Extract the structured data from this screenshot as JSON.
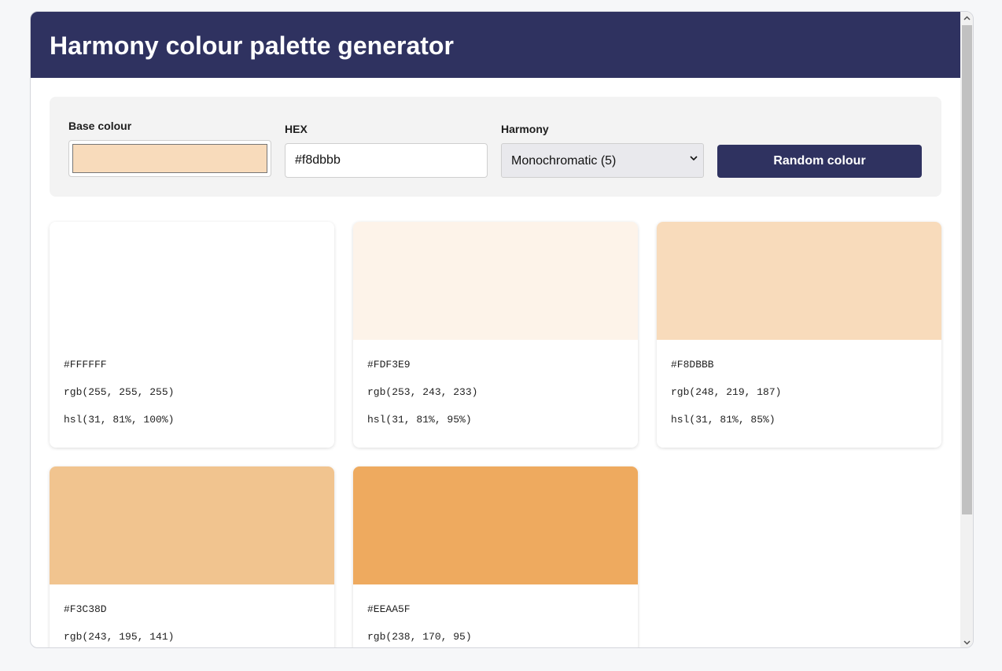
{
  "header": {
    "title": "Harmony colour palette generator"
  },
  "controls": {
    "base_colour_label": "Base colour",
    "base_colour_value": "#f8dbbb",
    "hex_label": "HEX",
    "hex_value": "#f8dbbb",
    "harmony_label": "Harmony",
    "harmony_selected": "Monochromatic (5)",
    "random_button": "Random colour"
  },
  "palette": [
    {
      "hex": "#FFFFFF",
      "rgb": "rgb(255, 255, 255)",
      "hsl": "hsl(31, 81%, 100%)",
      "color": "#ffffff"
    },
    {
      "hex": "#FDF3E9",
      "rgb": "rgb(253, 243, 233)",
      "hsl": "hsl(31, 81%, 95%)",
      "color": "#fdf3e9"
    },
    {
      "hex": "#F8DBBB",
      "rgb": "rgb(248, 219, 187)",
      "hsl": "hsl(31, 81%, 85%)",
      "color": "#f8dbbb"
    },
    {
      "hex": "#F3C38D",
      "rgb": "rgb(243, 195, 141)",
      "hsl": "",
      "color": "#f1c48f"
    },
    {
      "hex": "#EEAA5F",
      "rgb": "rgb(238, 170, 95)",
      "hsl": "",
      "color": "#eeaa5f"
    }
  ],
  "icons": {
    "select_chevron": "chevron-down-icon",
    "scroll_up": "arrow-up-icon",
    "scroll_down": "arrow-down-icon"
  }
}
